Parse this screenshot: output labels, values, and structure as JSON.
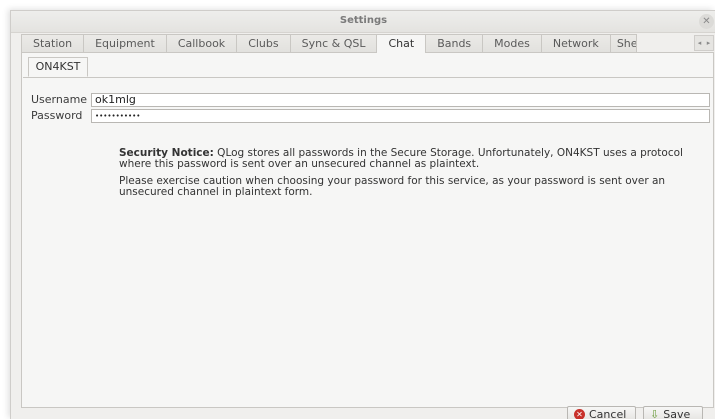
{
  "window": {
    "title": "Settings",
    "close_glyph": "✕"
  },
  "tabs": [
    {
      "label": "Station"
    },
    {
      "label": "Equipment"
    },
    {
      "label": "Callbook"
    },
    {
      "label": "Clubs"
    },
    {
      "label": "Sync & QSL"
    },
    {
      "label": "Chat",
      "active": true
    },
    {
      "label": "Bands"
    },
    {
      "label": "Modes"
    },
    {
      "label": "Network"
    },
    {
      "label": "She"
    }
  ],
  "tab_scroll": {
    "left": "◂",
    "right": "▸"
  },
  "subtab": {
    "label": "ON4KST"
  },
  "form": {
    "username_label": "Username",
    "username_value": "ok1mlg",
    "password_label": "Password",
    "password_value": "•••••••••••"
  },
  "notice": {
    "heading": "Security Notice:",
    "line1": " QLog stores all passwords in the Secure Storage. Unfortunately, ON4KST uses a protocol where this password is sent over an unsecured channel as plaintext.",
    "line2": "Please exercise caution when choosing your password for this service, as your password is sent over an unsecured channel in plaintext form."
  },
  "buttons": {
    "cancel_label": "Cancel",
    "save_label": "Save"
  },
  "icons": {
    "close": "close-icon",
    "cancel": "cancel-icon",
    "save": "save-icon"
  }
}
